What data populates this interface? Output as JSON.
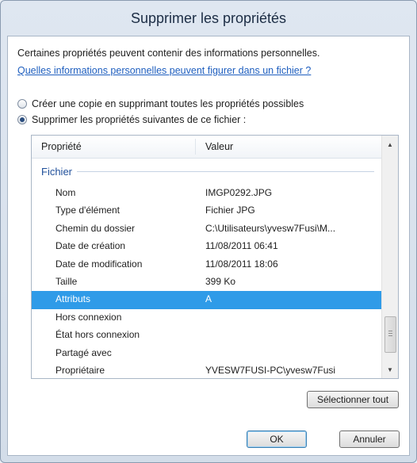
{
  "dialog": {
    "title": "Supprimer les propriétés"
  },
  "intro_text": "Certaines propriétés peuvent contenir des informations personnelles.",
  "info_link": "Quelles informations personnelles peuvent figurer dans un fichier ?",
  "options": [
    {
      "label": "Créer une copie en supprimant toutes les propriétés possibles",
      "checked": false
    },
    {
      "label": "Supprimer les propriétés suivantes de ce fichier :",
      "checked": true
    }
  ],
  "list": {
    "columns": [
      "Propriété",
      "Valeur"
    ],
    "group": "Fichier",
    "rows": [
      {
        "property": "Nom",
        "value": "IMGP0292.JPG"
      },
      {
        "property": "Type d'élément",
        "value": "Fichier JPG"
      },
      {
        "property": "Chemin du dossier",
        "value": "C:\\Utilisateurs\\yvesw7Fusi\\M..."
      },
      {
        "property": "Date de création",
        "value": "11/08/2011 06:41"
      },
      {
        "property": "Date de modification",
        "value": "11/08/2011 18:06"
      },
      {
        "property": "Taille",
        "value": "399 Ko"
      },
      {
        "property": "Attributs",
        "value": "A",
        "selected": true
      },
      {
        "property": "Hors connexion",
        "value": ""
      },
      {
        "property": "État hors connexion",
        "value": ""
      },
      {
        "property": "Partagé avec",
        "value": ""
      },
      {
        "property": "Propriétaire",
        "value": "YVESW7FUSI-PC\\yvesw7Fusi"
      }
    ]
  },
  "buttons": {
    "select_all": "Sélectionner tout",
    "ok": "OK",
    "cancel": "Annuler"
  },
  "colors": {
    "selection": "#2f9be8",
    "link": "#1f5fbf",
    "group": "#1f4f9a"
  },
  "icons": {
    "scroll_up": "triangle-up-icon",
    "scroll_down": "triangle-down-icon"
  }
}
